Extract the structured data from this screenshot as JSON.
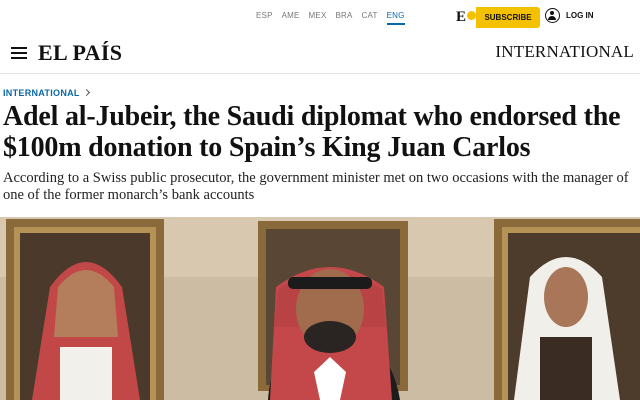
{
  "top_bar": {
    "editions": [
      {
        "label": "ESP",
        "active": false
      },
      {
        "label": "AME",
        "active": false
      },
      {
        "label": "MEX",
        "active": false
      },
      {
        "label": "BRA",
        "active": false
      },
      {
        "label": "CAT",
        "active": false
      },
      {
        "label": "ENG",
        "active": true
      }
    ],
    "epass_logo": "E",
    "subscribe_label": "SUBSCRIBE",
    "login_label": "LOG IN",
    "accent_color": "#f4c100",
    "edition_active_color": "#0b67a8"
  },
  "header": {
    "logo": "EL PAÍS",
    "section": "INTERNATIONAL"
  },
  "article": {
    "kicker": "INTERNATIONAL",
    "headline": "Adel al-Jubeir, the Saudi diplomat who endorsed the $100m donation to Spain’s King Juan Carlos",
    "subhead": "According to a Swiss public prosecutor, the government minister met on two occasions with the manager of one of the former monarch’s bank accounts",
    "kicker_color": "#0b67a8"
  }
}
